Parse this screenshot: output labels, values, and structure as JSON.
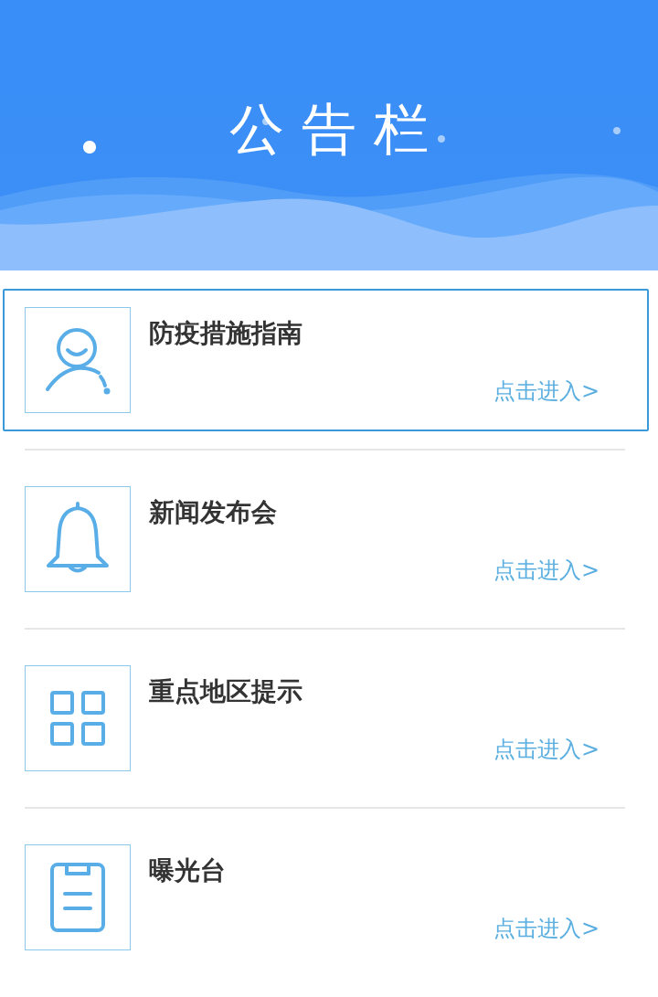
{
  "header": {
    "title": "公 告 栏"
  },
  "items": [
    {
      "kind": "person",
      "title": "防疫措施指南",
      "link": "点击进入>",
      "selected": true
    },
    {
      "kind": "bell",
      "title": "新闻发布会",
      "link": "点击进入>",
      "selected": false
    },
    {
      "kind": "grid",
      "title": "重点地区提示",
      "link": "点击进入>",
      "selected": false
    },
    {
      "kind": "clipboard",
      "title": "曝光台",
      "link": "点击进入>",
      "selected": false
    }
  ]
}
